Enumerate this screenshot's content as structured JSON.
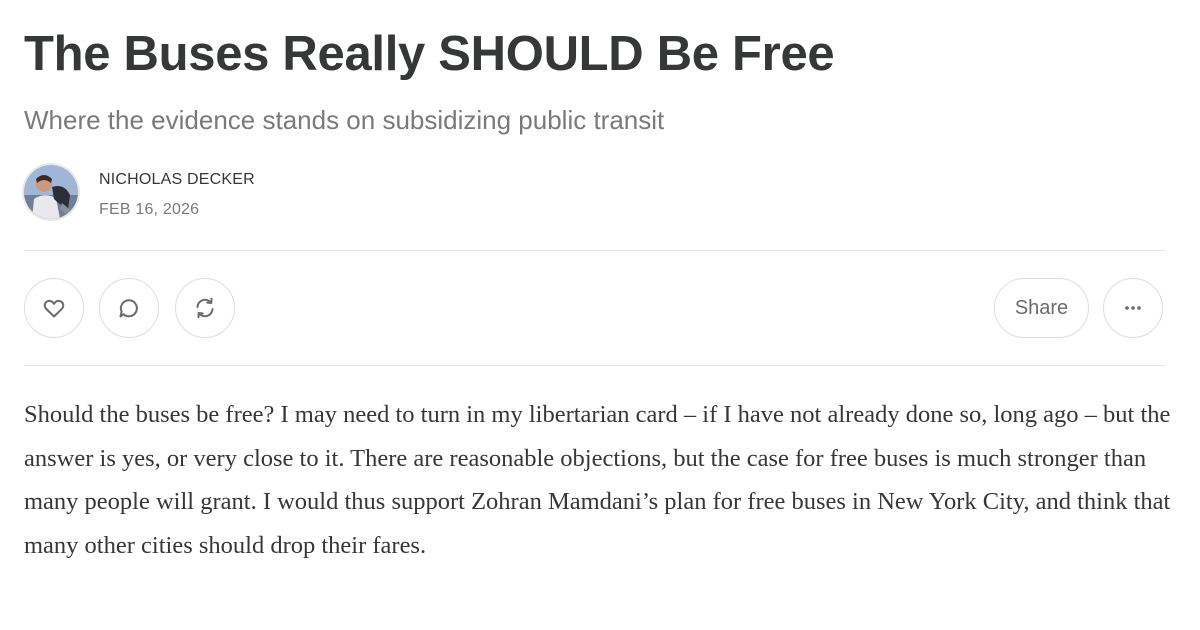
{
  "article": {
    "title": "The Buses Really SHOULD Be Free",
    "subtitle": "Where the evidence stands on subsidizing public transit",
    "author": "NICHOLAS DECKER",
    "date": "FEB 16, 2026",
    "body": "Should the buses be free? I may need to turn in my libertarian card – if I have not already done so, long ago – but the answer is yes, or very close to it. There are reasonable objections, but the case for free buses is much stronger than many people will grant. I would thus support Zohran Mamdani’s plan for free buses in New York City, and think that many other cities should drop their fares."
  },
  "actions": {
    "like_icon": "heart-icon",
    "comment_icon": "comment-icon",
    "restack_icon": "restack-icon",
    "share_label": "Share",
    "more_icon": "more-icon"
  },
  "colors": {
    "text": "#363737",
    "muted": "#7a7a7a",
    "border": "#dedede",
    "divider": "#e3e3e3"
  }
}
